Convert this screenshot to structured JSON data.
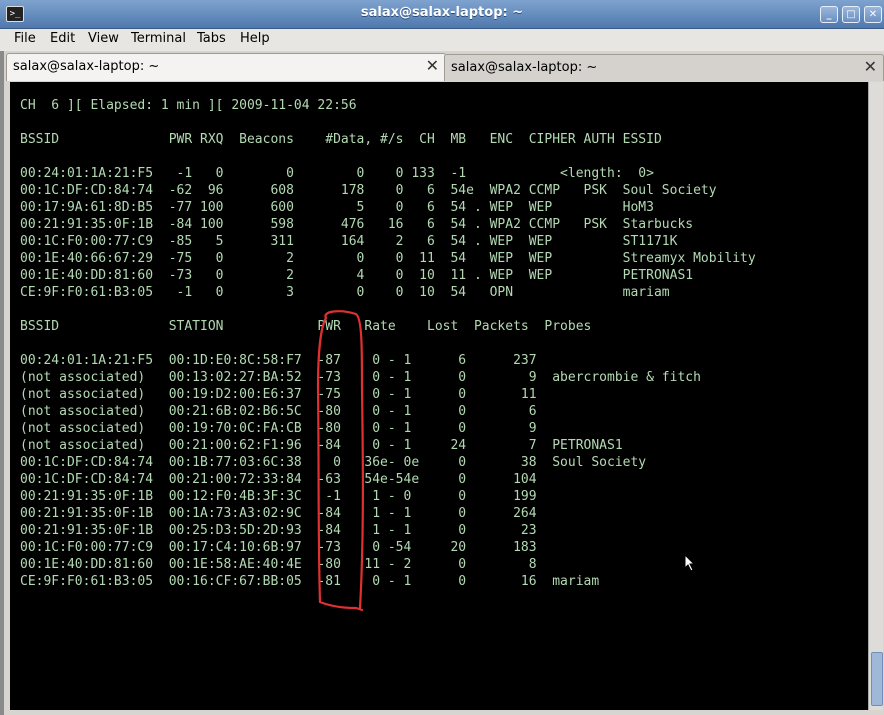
{
  "window": {
    "title": "salax@salax-laptop: ~",
    "icon": "terminal-icon",
    "minimize": "_",
    "maximize": "□",
    "close": "✕"
  },
  "menu": {
    "file": "File",
    "edit": "Edit",
    "view": "View",
    "terminal": "Terminal",
    "tabs": "Tabs",
    "help": "Help"
  },
  "tabs": [
    {
      "label": "salax@salax-laptop: ~",
      "close": "✕"
    },
    {
      "label": "salax@salax-laptop: ~",
      "close": "✕"
    }
  ],
  "terminal": {
    "header": "CH  6 ][ Elapsed: 1 min ][ 2009-11-04 22:56",
    "ap_header": "BSSID              PWR RXQ  Beacons    #Data, #/s  CH  MB   ENC  CIPHER AUTH ESSID",
    "aps": [
      "00:24:01:1A:21:F5   -1   0        0        0    0 133  -1            <length:  0>",
      "00:1C:DF:CD:84:74  -62  96      608      178    0   6  54e  WPA2 CCMP   PSK  Soul Society",
      "00:17:9A:61:8D:B5  -77 100      600        5    0   6  54 . WEP  WEP         HoM3",
      "00:21:91:35:0F:1B  -84 100      598      476   16   6  54 . WPA2 CCMP   PSK  Starbucks",
      "00:1C:F0:00:77:C9  -85   5      311      164    2   6  54 . WEP  WEP         ST1171K",
      "00:1E:40:66:67:29  -75   0        2        0    0  11  54   WEP  WEP         Streamyx Mobility",
      "00:1E:40:DD:81:60  -73   0        2        4    0  10  11 . WEP  WEP         PETRONAS1",
      "CE:9F:F0:61:B3:05   -1   0        3        0    0  10  54   OPN              mariam"
    ],
    "station_header": "BSSID              STATION            PWR   Rate    Lost  Packets  Probes",
    "stations": [
      "00:24:01:1A:21:F5  00:1D:E0:8C:58:F7  -87    0 - 1      6      237",
      "(not associated)   00:13:02:27:BA:52  -73    0 - 1      0        9  abercrombie & fitch",
      "(not associated)   00:19:D2:00:E6:37  -75    0 - 1      0       11",
      "(not associated)   00:21:6B:02:B6:5C  -80    0 - 1      0        6",
      "(not associated)   00:19:70:0C:FA:CB  -80    0 - 1      0        9",
      "(not associated)   00:21:00:62:F1:96  -84    0 - 1     24        7  PETRONAS1",
      "00:1C:DF:CD:84:74  00:1B:77:03:6C:38    0   36e- 0e     0       38  Soul Society",
      "00:1C:DF:CD:84:74  00:21:00:72:33:84  -63   54e-54e     0      104",
      "00:21:91:35:0F:1B  00:12:F0:4B:3F:3C   -1    1 - 0      0      199",
      "00:21:91:35:0F:1B  00:1A:73:A3:02:9C  -84    1 - 1      0      264",
      "00:21:91:35:0F:1B  00:25:D3:5D:2D:93  -84    1 - 1      0       23",
      "00:1C:F0:00:77:C9  00:17:C4:10:6B:97  -73    0 -54     20      183",
      "00:1E:40:DD:81:60  00:1E:58:AE:40:4E  -80   11 - 2      0        8",
      "CE:9F:F0:61:B3:05  00:16:CF:67:BB:05  -81    0 - 1      0       16  mariam"
    ]
  },
  "colors": {
    "terminal_bg": "#000000",
    "terminal_fg": "#b3d9b3",
    "annotation": "#e03030",
    "titlebar": "#5f86ba"
  }
}
